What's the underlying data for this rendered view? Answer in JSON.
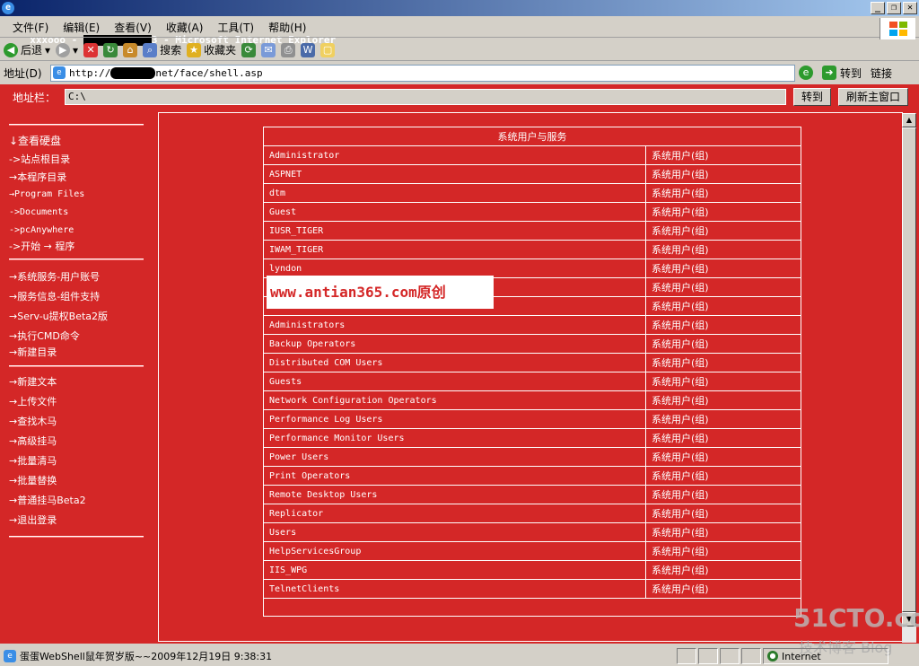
{
  "window": {
    "title_prefix": "xxxooo - ",
    "title_suffix": "3 - Microsoft Internet Explorer",
    "buttons": [
      "_",
      "❐",
      "✕"
    ]
  },
  "menubar": {
    "items": [
      "文件(F)",
      "编辑(E)",
      "查看(V)",
      "收藏(A)",
      "工具(T)",
      "帮助(H)"
    ]
  },
  "toolbar": {
    "back": "后退",
    "search": "搜索",
    "favorites": "收藏夹"
  },
  "addressbar": {
    "label": "地址(D)",
    "url_prefix": "http://",
    "url_suffix": "net/face/shell.asp",
    "go": "转到",
    "links": "链接"
  },
  "shell": {
    "addr_label": "地址栏：",
    "path": "C:\\",
    "go_button": "转到",
    "refresh_button": "刷新主窗口"
  },
  "sidebar": {
    "group1": [
      "↓查看硬盘",
      "->站点根目录",
      "→本程序目录",
      "→Program Files",
      "->Documents",
      "->pcAnywhere",
      "->开始 → 程序"
    ],
    "group2": [
      "→系统服务-用户账号",
      "→服务信息-组件支持",
      "→Serv-u提权Beta2版",
      "→执行CMD命令",
      "→新建目录"
    ],
    "group3": [
      "→新建文本",
      "→上传文件",
      "→查找木马",
      "→高级挂马",
      "→批量清马",
      "→批量替换",
      "→普通挂马Beta2",
      "→退出登录"
    ]
  },
  "users_table": {
    "header": "系统用户与服务",
    "group_label": "系统用户(组)",
    "rows": [
      "Administrator",
      "ASPNET",
      "dtm",
      "Guest",
      "IUSR_TIGER",
      "IWAM_TIGER",
      "lyndon",
      "",
      "",
      "Administrators",
      "Backup Operators",
      "Distributed COM Users",
      "Guests",
      "Network Configuration Operators",
      "Performance Log Users",
      "Performance Monitor Users",
      "Power Users",
      "Print Operators",
      "Remote Desktop Users",
      "Replicator",
      "Users",
      "HelpServicesGroup",
      "IIS_WPG",
      "TelnetClients"
    ]
  },
  "overlay": {
    "watermark": "www.antian365.com原创",
    "site_logo": "51CTO.com",
    "site_sub": "技术博客 Blog"
  },
  "statusbar": {
    "text": "蛋蛋WebShell鼠年贺岁版~~2009年12月19日 9:38:31",
    "zone": "Internet"
  },
  "colors": {
    "page_bg": "#d42727",
    "chrome": "#d4d0c8",
    "titlebar": "#0a246a"
  }
}
